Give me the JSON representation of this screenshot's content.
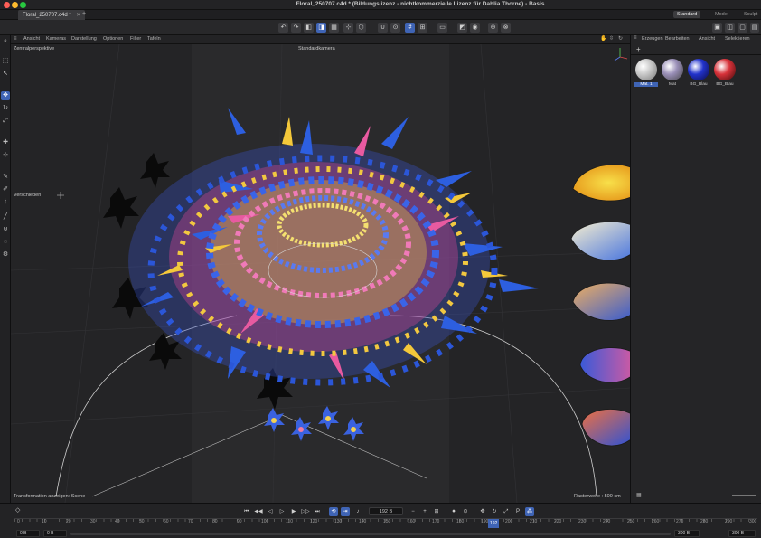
{
  "window": {
    "title": "Floral_250707.c4d * (Bildungslizenz - nichtkommerzielle Lizenz für Dahlia Thorne) - Basis"
  },
  "tabs": {
    "document_tab": "Floral_250707.c4d *",
    "add_tab": "+",
    "layouts": [
      "Standard",
      "Model",
      "Sculpt"
    ]
  },
  "viewport_menu": [
    "Ansicht",
    "Kameras",
    "Darstellung",
    "Optionen",
    "Filter",
    "Tafeln"
  ],
  "viewport": {
    "view_name": "Zentralperspektive",
    "camera_name": "Standardkamera",
    "hud_left": "Verschieben",
    "status_left": "Transformation anzeigen: Scene",
    "status_right": "Rasterweite : 500 cm"
  },
  "material_manager": {
    "menu": [
      "Erzeugen",
      "Bearbeiten",
      "Ansicht",
      "Selektieren"
    ],
    "materials": [
      {
        "label": "Mat. 1",
        "color": "#c9c9c9"
      },
      {
        "label": "Mat",
        "color": "#9a8fb8"
      },
      {
        "label": "BG_Blau",
        "color": "#2233cc"
      },
      {
        "label": "BG_Blau",
        "color": "#d8323a"
      }
    ]
  },
  "timeline": {
    "current_frame": "192 B",
    "ruler": [
      "0",
      "10",
      "20",
      "30",
      "40",
      "50",
      "60",
      "70",
      "80",
      "90",
      "100",
      "110",
      "120",
      "130",
      "140",
      "150",
      "160",
      "170",
      "180",
      "190",
      "200",
      "210",
      "220",
      "230",
      "240",
      "250",
      "260",
      "270",
      "280",
      "290",
      "300"
    ],
    "playhead_marker": "192",
    "start_field": "0 B",
    "start_field_2": "0 B",
    "end_field": "300 B",
    "end_field_2": "300 B"
  },
  "colors": {
    "accent": "#3f64b5",
    "viewport_bg": "#2a2a2c",
    "panel_bg": "#252527"
  }
}
